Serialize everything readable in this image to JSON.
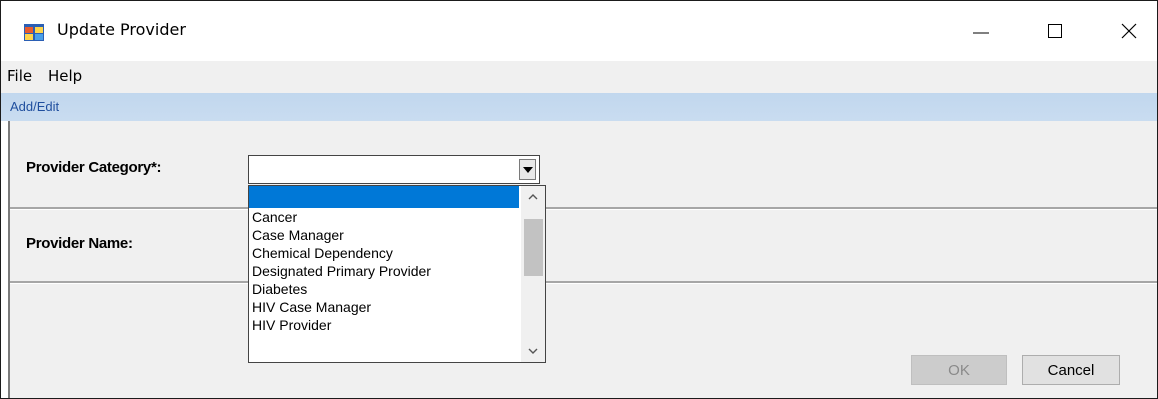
{
  "window": {
    "title": "Update Provider",
    "icon": "application-icon"
  },
  "menu": {
    "items": [
      "File",
      "Help"
    ]
  },
  "tab": {
    "label": "Add/Edit"
  },
  "form": {
    "provider_category_label": "Provider Category*:",
    "provider_category_value": "",
    "provider_name_label": "Provider Name:"
  },
  "dropdown": {
    "items": [
      "",
      "Cancer",
      "Case Manager",
      "Chemical Dependency",
      "Designated Primary Provider",
      "Diabetes",
      "HIV Case Manager",
      "HIV Provider"
    ],
    "selected_index": 0
  },
  "buttons": {
    "ok_label": "OK",
    "cancel_label": "Cancel"
  },
  "colors": {
    "selection": "#0078d7",
    "tab_strip": "#c4d9ef",
    "tab_text": "#1f4e9e",
    "disabled_text": "#8a8a8a"
  }
}
